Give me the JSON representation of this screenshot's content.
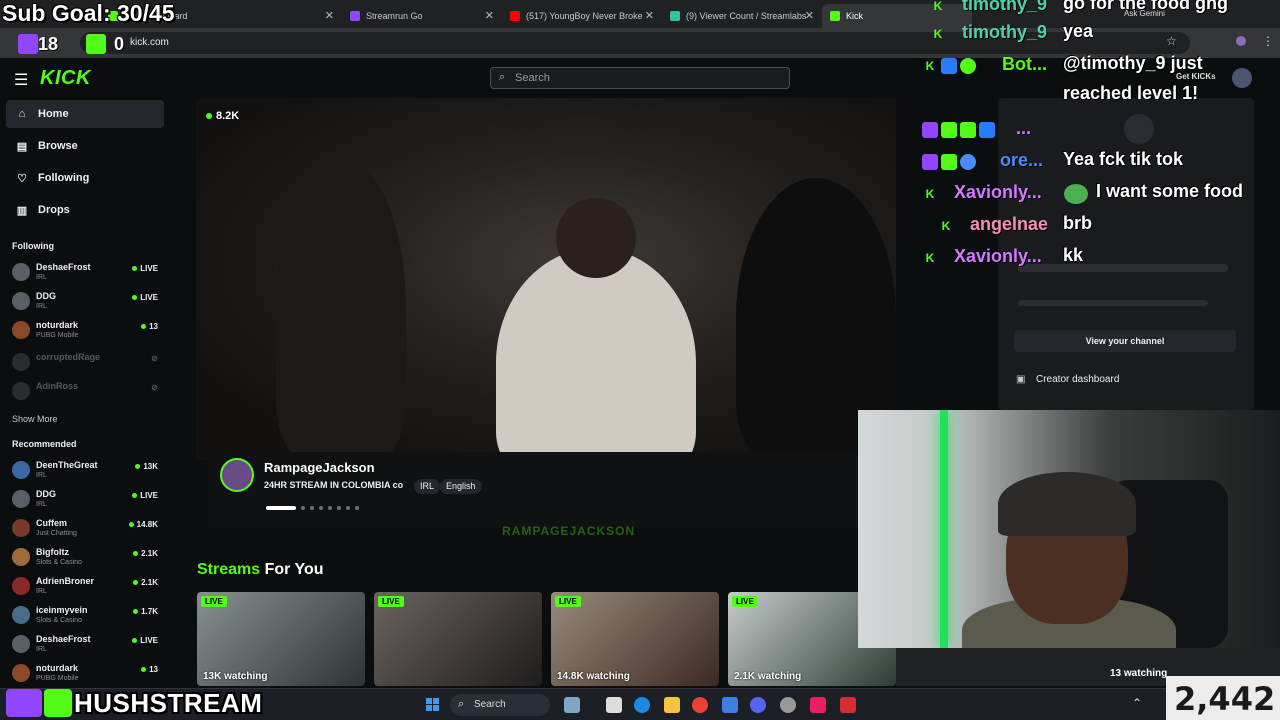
{
  "browser": {
    "tabs": [
      {
        "label": "Kick Dashboard",
        "color": "#53fc18"
      },
      {
        "label": "Streamrun Go",
        "color": "#9146ff"
      },
      {
        "label": "(517) YoungBoy Never Broke",
        "color": "#ff0000"
      },
      {
        "label": "(9) Viewer Count / Streamlabs",
        "color": "#31c3a2"
      },
      {
        "label": "Kick",
        "color": "#53fc18"
      }
    ],
    "url": "kick.com",
    "gemini": "Ask Gemini"
  },
  "header": {
    "logo": "KICK",
    "search_placeholder": "Search",
    "get_kicks": "Get KICKs"
  },
  "sidebar": {
    "nav": [
      {
        "label": "Home",
        "icon": "home-icon",
        "glyph": "⌂"
      },
      {
        "label": "Browse",
        "icon": "browse-icon",
        "glyph": "▤"
      },
      {
        "label": "Following",
        "icon": "heart-icon",
        "glyph": "♡"
      },
      {
        "label": "Drops",
        "icon": "drops-icon",
        "glyph": "▥"
      }
    ],
    "following_title": "Following",
    "following": [
      {
        "name": "DeshaeFrost",
        "category": "IRL",
        "status": "LIVE"
      },
      {
        "name": "DDG",
        "category": "IRL",
        "status": "LIVE"
      },
      {
        "name": "noturdark",
        "category": "PUBG Mobile",
        "status": "13"
      },
      {
        "name": "corruptedRage",
        "category": "",
        "status": ""
      },
      {
        "name": "AdinRoss",
        "category": "",
        "status": ""
      }
    ],
    "show_more": "Show More",
    "recommended_title": "Recommended",
    "recommended": [
      {
        "name": "DeenTheGreat",
        "category": "IRL",
        "status": "13K"
      },
      {
        "name": "DDG",
        "category": "IRL",
        "status": "LIVE"
      },
      {
        "name": "Cuffem",
        "category": "Just Chatting",
        "status": "14.8K"
      },
      {
        "name": "Bigfoltz",
        "category": "Slots & Casino",
        "status": "2.1K"
      },
      {
        "name": "AdrienBroner",
        "category": "IRL",
        "status": "2.1K"
      },
      {
        "name": "iceinmyvein",
        "category": "Slots & Casino",
        "status": "1.7K"
      },
      {
        "name": "DeshaeFrost",
        "category": "IRL",
        "status": "LIVE"
      },
      {
        "name": "noturdark",
        "category": "PUBG Mobile",
        "status": "13"
      }
    ]
  },
  "featured": {
    "viewers": "8.2K",
    "streamer": "RampageJackson",
    "title": "24HR STREAM IN COLOMBIA co",
    "tags": [
      "IRL",
      "English"
    ],
    "watermark": "RAMPAGEJACKSON"
  },
  "streams_for_you": {
    "heading_accent": "Streams",
    "heading_rest": " For You",
    "live_label": "LIVE",
    "cards": [
      {
        "watching": "13K watching"
      },
      {
        "watching": ""
      },
      {
        "watching": "14.8K watching"
      },
      {
        "watching": "2.1K watching"
      },
      {
        "watching": "13 watching"
      }
    ]
  },
  "user_menu": {
    "view_channel": "View your channel",
    "creator_dashboard": "Creator dashboard"
  },
  "overlay": {
    "sub_goal": "Sub Goal: 30/45",
    "stat_a": "18",
    "stat_b": "0",
    "chat": [
      {
        "user": "timothy_9",
        "text": "go for the food gng",
        "color": "#4ed3a8"
      },
      {
        "user": "timothy_9",
        "text": "yea",
        "color": "#4ed3a8"
      },
      {
        "user": "Bot...",
        "text": "@timothy_9 just reached level 1!",
        "color": "#53fc18"
      },
      {
        "user": "...",
        "text": "",
        "color": "#c77dff"
      },
      {
        "user": "ore...",
        "text": "Yea fck tik tok",
        "color": "#4a8cff"
      },
      {
        "user": "Xavionly...",
        "text": "I want some food",
        "color": "#d478ff"
      },
      {
        "user": "angelnae",
        "text": "brb",
        "color": "#f48fb1"
      },
      {
        "user": "Xavionly...",
        "text": "kk",
        "color": "#d478ff"
      }
    ],
    "brand": "HUSHSTREAM",
    "viewer_count": "2,442"
  },
  "taskbar": {
    "search": "Search"
  }
}
